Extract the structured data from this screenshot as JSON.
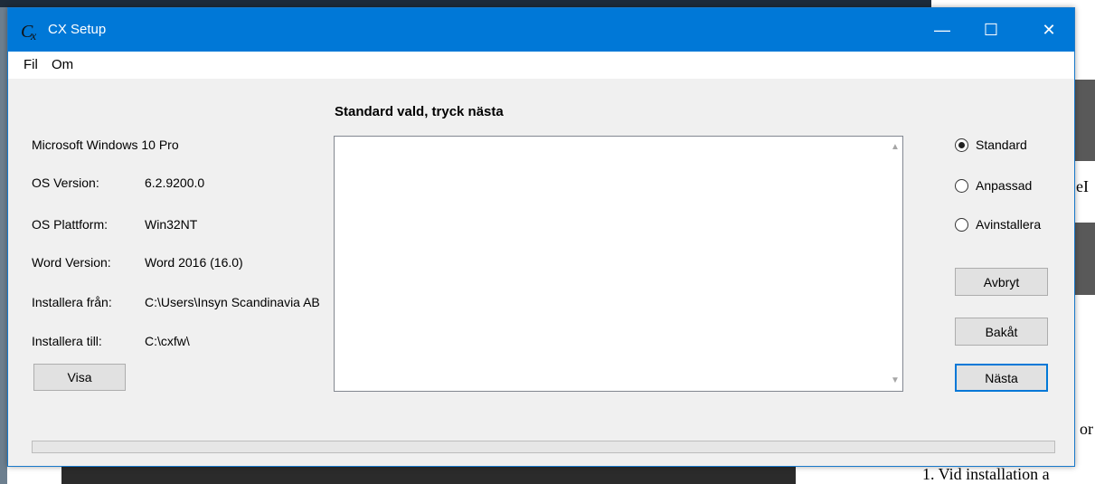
{
  "window": {
    "title": "CX Setup",
    "icon": "cx-app-icon",
    "controls": {
      "minimize": "—",
      "maximize": "☐",
      "close": "✕"
    }
  },
  "menu": {
    "items": [
      "Fil",
      "Om"
    ]
  },
  "info": {
    "os_name": "Microsoft Windows 10 Pro",
    "rows": [
      {
        "label": "OS Version:",
        "value": "6.2.9200.0"
      },
      {
        "label": "OS Plattform:",
        "value": "Win32NT"
      },
      {
        "label": "Word Version:",
        "value": "Word 2016 (16.0)"
      },
      {
        "label": "Installera från:",
        "value": "C:\\Users\\Insyn Scandinavia AB"
      },
      {
        "label": "Installera till:",
        "value": "C:\\cxfw\\"
      }
    ],
    "show_button": "Visa"
  },
  "main": {
    "heading": "Standard vald, tryck nästa",
    "log_text": ""
  },
  "options": {
    "radios": [
      {
        "label": "Standard",
        "checked": true
      },
      {
        "label": "Anpassad",
        "checked": false
      },
      {
        "label": "Avinstallera",
        "checked": false
      }
    ],
    "cancel": "Avbryt",
    "back": "Bakåt",
    "next": "Nästa"
  },
  "progress": {
    "value": 0
  },
  "background": {
    "doc_fragment_1": "eI",
    "doc_fragment_2": "or",
    "doc_fragment_3": "1.  Vid installation a"
  },
  "colors": {
    "titlebar": "#0078d7",
    "window": "#f0f0f0",
    "accent": "#0078d7"
  }
}
